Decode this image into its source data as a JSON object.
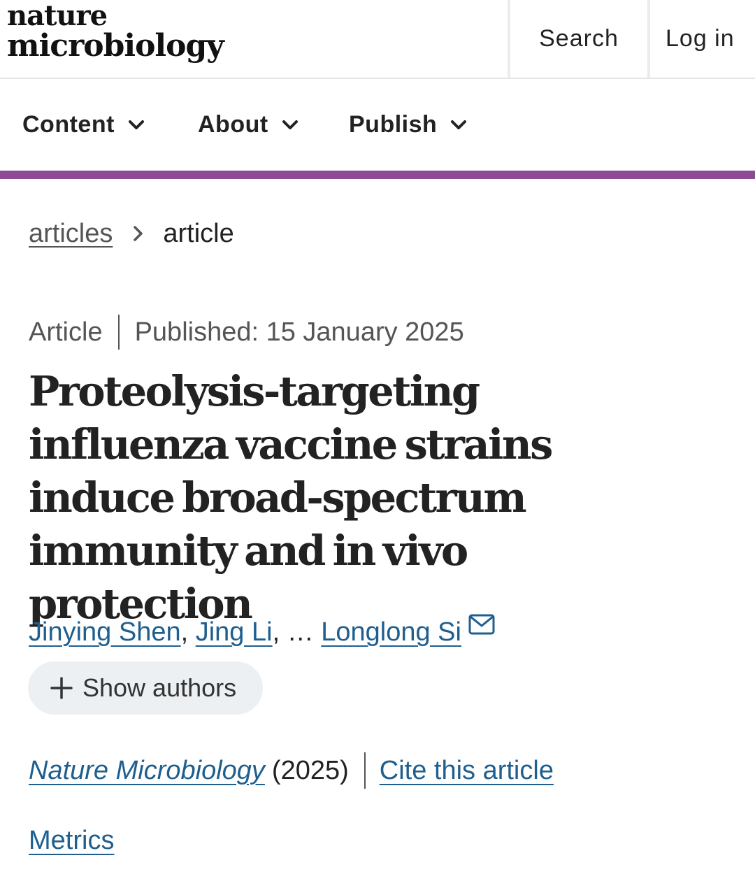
{
  "header": {
    "logo_line1": "nature",
    "logo_line2": "microbiology",
    "search_label": "Search",
    "login_label": "Log in"
  },
  "nav": {
    "items": [
      {
        "label": "Content",
        "icon": "chevron-down-icon"
      },
      {
        "label": "About",
        "icon": "chevron-down-icon"
      },
      {
        "label": "Publish",
        "icon": "chevron-down-icon"
      }
    ],
    "accent_color": "#8d4b96"
  },
  "breadcrumb": {
    "parent": "articles",
    "current": "article",
    "separator_icon": "chevron-right-icon"
  },
  "article": {
    "type": "Article",
    "published": "Published: 15 January 2025",
    "title": "Proteolysis-targeting influenza vaccine strains induce broad-spectrum immunity and in vivo protection",
    "authors": {
      "first": "Jinying Shen",
      "second": "Jing Li",
      "ellipsis": "…",
      "last": "Longlong Si",
      "last_icon": "mail-icon"
    },
    "show_authors_label": "Show authors",
    "journal": "Nature Microbiology",
    "year": "(2025)",
    "cite_label": "Cite this article",
    "metrics_label": "Metrics"
  },
  "colors": {
    "link": "#1f5f8f",
    "pill_bg": "#edf0f3"
  }
}
